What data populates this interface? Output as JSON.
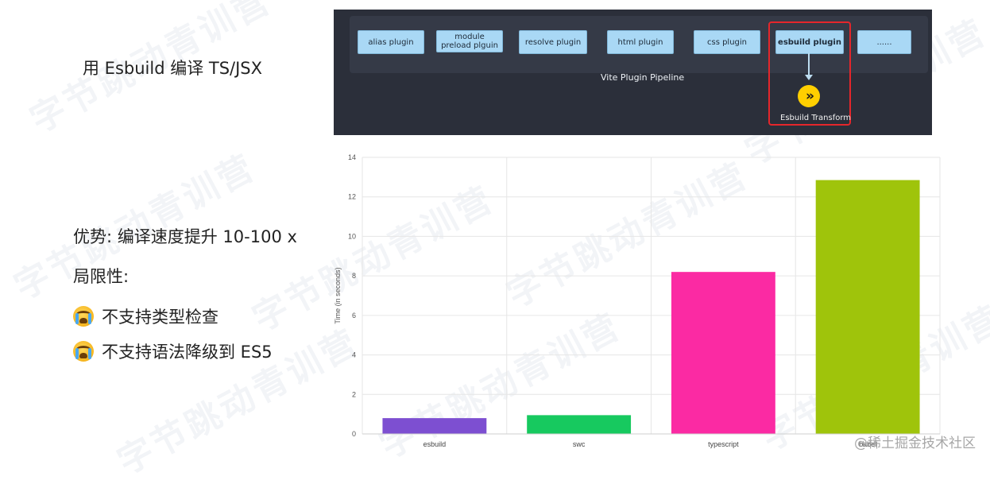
{
  "slide": {
    "heading": "用 Esbuild 编译 TS/JSX",
    "advantage": "优势: 编译速度提升 10-100 x",
    "limitation_title": "局限性:",
    "limitations": [
      "不支持类型检查",
      "不支持语法降级到 ES5"
    ],
    "corner_watermark": "@稀土掘金技术社区",
    "background_watermark": "字节跳动青训营"
  },
  "pipeline": {
    "plugins": [
      {
        "label": "alias plugin"
      },
      {
        "label": "module preload plguin"
      },
      {
        "label": "resolve plugin"
      },
      {
        "label": "html plugin"
      },
      {
        "label": "css plugin"
      },
      {
        "label": "esbuild plugin"
      },
      {
        "label": "......"
      }
    ],
    "pipeline_label": "Vite Plugin Pipeline",
    "transform_label": "Esbuild Transform",
    "highlight_color": "#e5262b",
    "box_color": "#a9d8f5",
    "panel_color": "#2b2f3a"
  },
  "chart_data": {
    "type": "bar",
    "categories": [
      "esbuild",
      "swc",
      "typescript",
      "babel"
    ],
    "values": [
      0.8,
      0.95,
      8.2,
      12.85
    ],
    "colors": [
      "#7d4fd1",
      "#17c95f",
      "#fb2aa3",
      "#9fc40b"
    ],
    "ylabel": "Time (in seconds)",
    "ylim": [
      0,
      14
    ],
    "yticks": [
      0,
      2,
      4,
      6,
      8,
      10,
      12,
      14
    ],
    "grid": true
  }
}
